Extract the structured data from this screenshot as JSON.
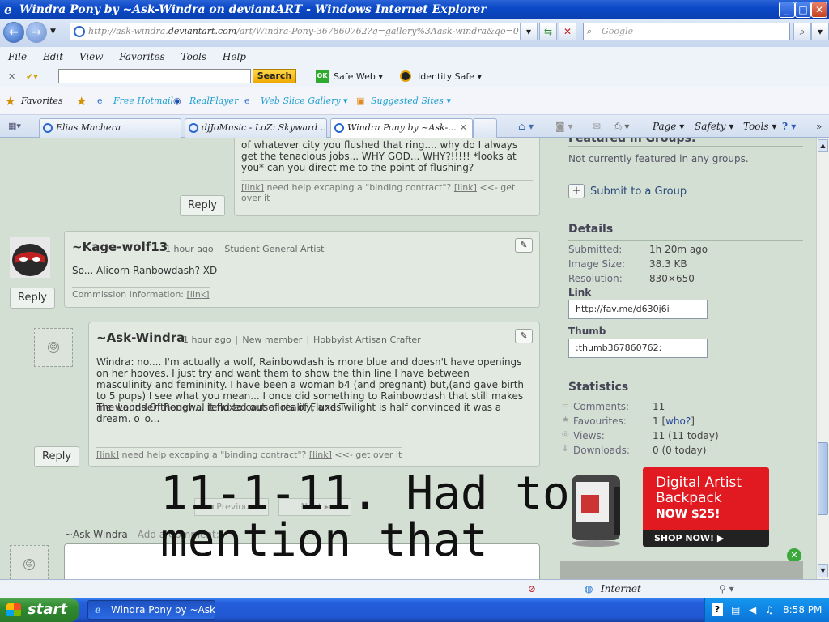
{
  "window": {
    "title": "Windra Pony by ~Ask-Windra on deviantART - Windows Internet Explorer",
    "min": "_",
    "max": "□",
    "close": "✕"
  },
  "address": {
    "url_prefix": "http://ask-windra.",
    "url_domain": "deviantart.com",
    "url_rest": "/art/Windra-Pony-367860762?q=gallery%3Aask-windra&qo=0",
    "search_placeholder": "Google"
  },
  "menu": [
    "File",
    "Edit",
    "View",
    "Favorites",
    "Tools",
    "Help"
  ],
  "toolbar": {
    "search_button": "Search",
    "safe_web_badge": "OK",
    "safe_web": "Safe Web",
    "identity_safe": "Identity Safe"
  },
  "favorites": {
    "label": "Favorites",
    "items": [
      "Free Hotmail",
      "RealPlayer",
      "Web Slice Gallery",
      "Suggested Sites"
    ]
  },
  "tabs": [
    {
      "label": "Elias Machera",
      "active": false
    },
    {
      "label": "djJoMusic - LoZ: Skyward ...",
      "active": false
    },
    {
      "label": "Windra Pony by ~Ask-...",
      "active": true
    }
  ],
  "commands": [
    "Page",
    "Safety",
    "Tools"
  ],
  "comments": [
    {
      "text": "of whatever city you flushed that ring.... why do I always get the tenacious jobs... WHY GOD... WHY?!!!!! *looks at you* can you direct me to the point of flushing?",
      "sig_link1": "[link]",
      "sig_mid": "need help excaping a \"binding contract\"?",
      "sig_link2": "[link]",
      "sig_tail": "<<- get over it",
      "reply": "Reply"
    },
    {
      "author": "~Kage-wolf13",
      "time": "1 hour ago",
      "role": "Student General Artist",
      "text": "So... Alicorn Ranbowdash? XD",
      "sig_label": "Commission Information:",
      "sig_link": "[link]",
      "reply": "Reply"
    },
    {
      "author": "~Ask-Windra",
      "time": "1 hour ago",
      "badge": "New member",
      "role": "Hobbyist Artisan Crafter",
      "text": "Windra: no.... I'm actually a wolf, Rainbowdash is more blue and doesn't have openings on her hooves. I just try and want them to show the thin line I have between masculinity and femininity. I have been a woman b4 (and pregnant) but,(and gave birth to 5 pups) I see what you mean... I once did something to Rainbowdash that still makes me wounder though... it fluxed out of reality, and Twilight is half convinced it was a dream. o_o...",
      "text2": "The Lands Of Renewal tend to cause lots of Fluxes",
      "sig_link1": "[link]",
      "sig_mid": "need help excaping a \"binding contract\"?",
      "sig_link2": "[link]",
      "sig_tail": "<<- get over it",
      "reply": "Reply"
    }
  ],
  "pager": {
    "prev": "Previous",
    "next": "Next"
  },
  "add_comment": {
    "user": "~Ask-Windra",
    "sep": " - ",
    "label": "Add a Comment:"
  },
  "sidebar": {
    "groups_heading": "Featured in Groups:",
    "groups_text": "Not currently featured in any groups.",
    "submit_group": "Submit to a Group",
    "details_heading": "Details",
    "details": [
      {
        "label": "Submitted:",
        "value": "1h 20m ago"
      },
      {
        "label": "Image Size:",
        "value": "38.3 KB"
      },
      {
        "label": "Resolution:",
        "value": "830×650"
      }
    ],
    "link_label": "Link",
    "link_value": "http://fav.me/d630j6i",
    "thumb_label": "Thumb",
    "thumb_value": ":thumb367860762:",
    "stats_heading": "Statistics",
    "stats": [
      {
        "label": "Comments:",
        "value": "11",
        "extra": ""
      },
      {
        "label": "Favourites:",
        "value": "1 [",
        "extra": "who?",
        "tail": "]"
      },
      {
        "label": "Views:",
        "value": "11 (11 today)",
        "extra": ""
      },
      {
        "label": "Downloads:",
        "value": "0 (0 today)",
        "extra": ""
      }
    ]
  },
  "ad": {
    "line1": "Digital Artist",
    "line2": "Backpack",
    "price": "NOW $25!",
    "cta": "SHOP NOW!"
  },
  "overlay_text": "11-1-11. Had to\nmention that",
  "status": {
    "zone": "Internet"
  },
  "taskbar": {
    "start": "start",
    "item": "Windra Pony by ~Ask...",
    "clock": "8:58 PM"
  }
}
